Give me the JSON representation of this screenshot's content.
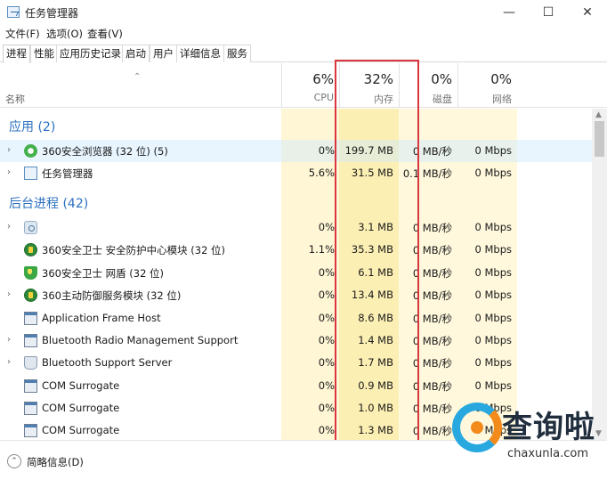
{
  "window": {
    "title": "任务管理器",
    "minimize": "—",
    "maximize": "☐",
    "close": "✕"
  },
  "menu": [
    "文件(F)",
    "选项(O)",
    "查看(V)"
  ],
  "tabs": [
    "进程",
    "性能",
    "应用历史记录",
    "启动",
    "用户",
    "详细信息",
    "服务"
  ],
  "active_tab": "进程",
  "columns": {
    "name": "名称",
    "cpu": {
      "percent": "6%",
      "label": "CPU"
    },
    "memory": {
      "percent": "32%",
      "label": "内存"
    },
    "disk": {
      "percent": "0%",
      "label": "磁盘"
    },
    "network": {
      "percent": "0%",
      "label": "网络"
    }
  },
  "groups": {
    "apps": "应用 (2)",
    "background": "后台进程 (42)"
  },
  "rows": [
    {
      "name": "360安全浏览器 (32 位) (5)",
      "cpu": "0%",
      "mem": "199.7 MB",
      "disk": "0 MB/秒",
      "net": "0 Mbps",
      "icon": "browser-360-icon"
    },
    {
      "name": "任务管理器",
      "cpu": "5.6%",
      "mem": "31.5 MB",
      "disk": "0.1 MB/秒",
      "net": "0 Mbps",
      "icon": "task-manager-icon"
    },
    {
      "name": "",
      "cpu": "0%",
      "mem": "3.1 MB",
      "disk": "0 MB/秒",
      "net": "0 Mbps",
      "icon": "gear-icon"
    },
    {
      "name": "360安全卫士 安全防护中心模块 (32 位)",
      "cpu": "1.1%",
      "mem": "35.3 MB",
      "disk": "0 MB/秒",
      "net": "0 Mbps",
      "icon": "guard-360-icon"
    },
    {
      "name": "360安全卫士 网盾 (32 位)",
      "cpu": "0%",
      "mem": "6.1 MB",
      "disk": "0 MB/秒",
      "net": "0 Mbps",
      "icon": "shield-icon"
    },
    {
      "name": "360主动防御服务模块 (32 位)",
      "cpu": "0%",
      "mem": "13.4 MB",
      "disk": "0 MB/秒",
      "net": "0 Mbps",
      "icon": "guard-360-icon"
    },
    {
      "name": "Application Frame Host",
      "cpu": "0%",
      "mem": "8.6 MB",
      "disk": "0 MB/秒",
      "net": "0 Mbps",
      "icon": "window-icon"
    },
    {
      "name": "Bluetooth Radio Management Support",
      "cpu": "0%",
      "mem": "1.4 MB",
      "disk": "0 MB/秒",
      "net": "0 Mbps",
      "icon": "window-icon"
    },
    {
      "name": "Bluetooth Support Server",
      "cpu": "0%",
      "mem": "1.7 MB",
      "disk": "0 MB/秒",
      "net": "0 Mbps",
      "icon": "bluetooth-icon"
    },
    {
      "name": "COM Surrogate",
      "cpu": "0%",
      "mem": "0.9 MB",
      "disk": "0 MB/秒",
      "net": "0 Mbps",
      "icon": "window-icon"
    },
    {
      "name": "COM Surrogate",
      "cpu": "0%",
      "mem": "1.0 MB",
      "disk": "0 MB/秒",
      "net": "0 Mbps",
      "icon": "window-icon"
    },
    {
      "name": "COM Surrogate",
      "cpu": "0%",
      "mem": "1.3 MB",
      "disk": "0 MB/秒",
      "net": "0 Mbps",
      "icon": "window-icon"
    }
  ],
  "footer": {
    "label": "简略信息(D)"
  },
  "watermark": {
    "text": "查询啦",
    "url": "chaxunla.com"
  },
  "colors": {
    "accent": "#2a6fbf",
    "highlight_red": "#d9363e",
    "cpu_heat": "#fff6d6",
    "mem_heat": "#fcefb4"
  }
}
